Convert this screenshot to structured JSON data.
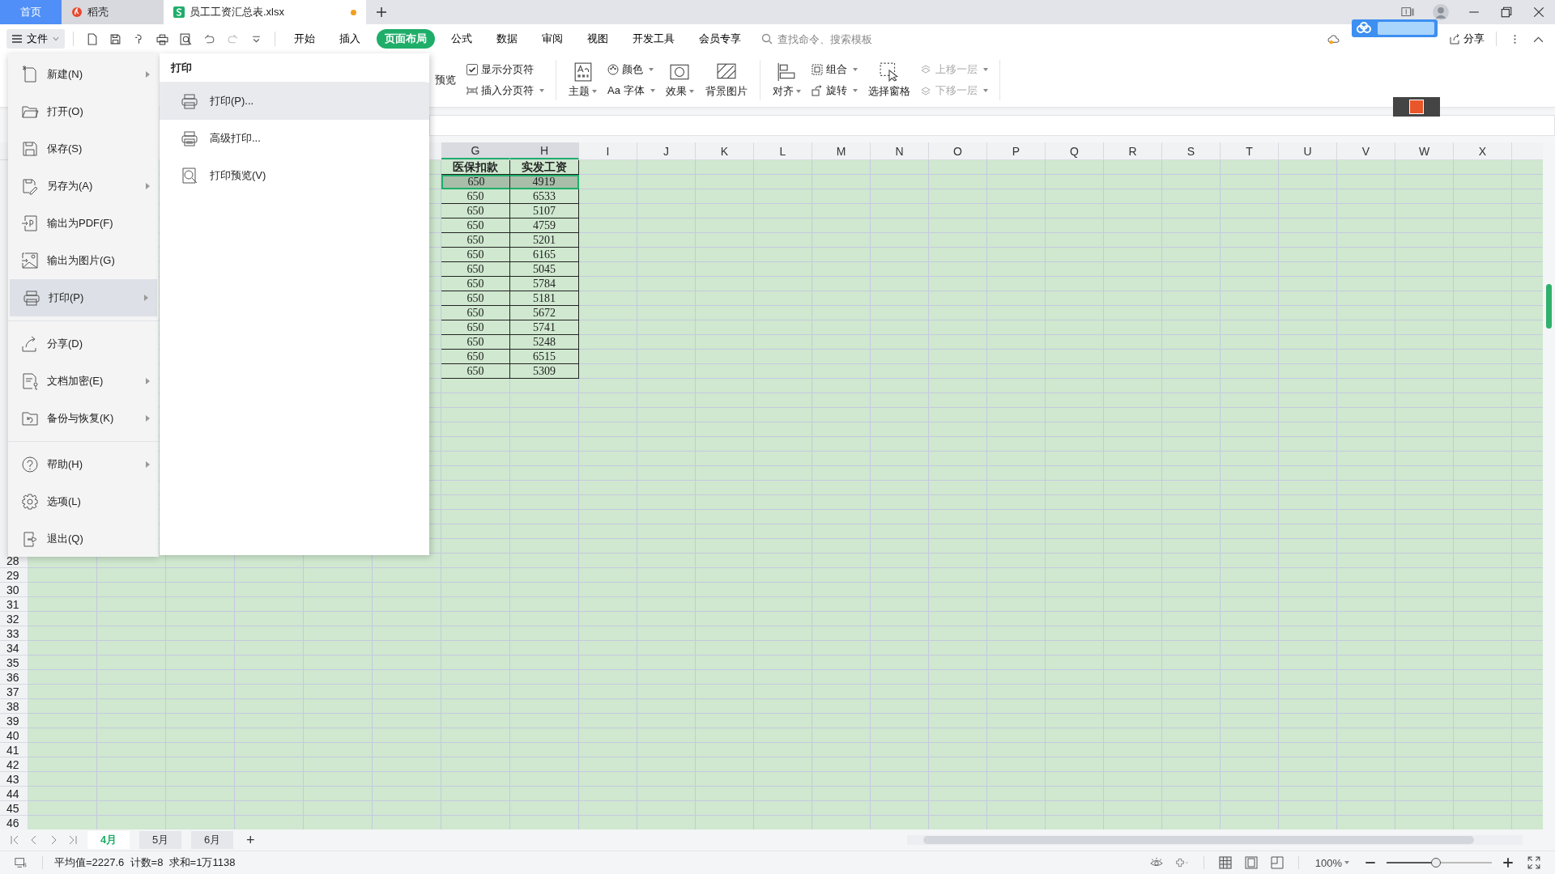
{
  "title_tabs": [
    {
      "label": "首页",
      "kind": "home",
      "selected": false,
      "unsaved": false
    },
    {
      "label": "稻壳",
      "kind": "docer",
      "selected": false,
      "unsaved": false
    },
    {
      "label": "员工工资汇总表.xlsx",
      "kind": "sheet",
      "selected": true,
      "unsaved": true
    }
  ],
  "file_button": "文件",
  "ribbon_tabs": [
    {
      "label": "开始",
      "selected": false
    },
    {
      "label": "插入",
      "selected": false
    },
    {
      "label": "页面布局",
      "selected": true
    },
    {
      "label": "公式",
      "selected": false
    },
    {
      "label": "数据",
      "selected": false
    },
    {
      "label": "审阅",
      "selected": false
    },
    {
      "label": "视图",
      "selected": false
    },
    {
      "label": "开发工具",
      "selected": false
    },
    {
      "label": "会员专享",
      "selected": false
    }
  ],
  "search": {
    "placeholder": "查找命令、搜索模板"
  },
  "share": "分享",
  "ribbon": {
    "preview": "预览",
    "show_page_breaks": {
      "label": "显示分页符",
      "checked": true
    },
    "insert_page_break": "插入分页符",
    "theme": "主题",
    "colors": "颜色",
    "fonts": {
      "prefix": "Aa",
      "label": "字体"
    },
    "effects": "效果",
    "background": "背景图片",
    "align": "对齐",
    "group": "组合",
    "rotate": "旋转",
    "selection_pane": "选择窗格",
    "bring_forward": {
      "label": "上移一层",
      "disabled": true
    },
    "send_backward": {
      "label": "下移一层",
      "disabled": true
    }
  },
  "file_menu": {
    "groups": [
      [
        {
          "label": "新建(N)",
          "kind": "new",
          "submenu": true,
          "selected": false
        },
        {
          "label": "打开(O)",
          "kind": "open",
          "submenu": false,
          "selected": false
        },
        {
          "label": "保存(S)",
          "kind": "save",
          "submenu": false,
          "selected": false
        },
        {
          "label": "另存为(A)",
          "kind": "save_as",
          "submenu": true,
          "selected": false
        },
        {
          "label": "输出为PDF(F)",
          "kind": "pdf",
          "submenu": false,
          "selected": false
        },
        {
          "label": "输出为图片(G)",
          "kind": "image",
          "submenu": false,
          "selected": false
        },
        {
          "label": "打印(P)",
          "kind": "print",
          "submenu": true,
          "selected": true
        }
      ],
      [
        {
          "label": "分享(D)",
          "kind": "share",
          "submenu": false,
          "selected": false
        },
        {
          "label": "文档加密(E)",
          "kind": "encrypt",
          "submenu": true,
          "selected": false
        },
        {
          "label": "备份与恢复(K)",
          "kind": "backup",
          "submenu": true,
          "selected": false
        }
      ],
      [
        {
          "label": "帮助(H)",
          "kind": "help",
          "submenu": true,
          "selected": false
        },
        {
          "label": "选项(L)",
          "kind": "options",
          "submenu": false,
          "selected": false
        },
        {
          "label": "退出(Q)",
          "kind": "exit",
          "submenu": false,
          "selected": false
        }
      ]
    ]
  },
  "submenu": {
    "title": "打印",
    "items": [
      {
        "label": "打印(P)...",
        "kind": "print",
        "selected": true
      },
      {
        "label": "高级打印...",
        "kind": "advanced",
        "selected": false
      },
      {
        "label": "打印预览(V)",
        "kind": "preview",
        "selected": false
      }
    ]
  },
  "columns": [
    "G",
    "H",
    "I",
    "J",
    "K",
    "L",
    "M",
    "N",
    "O",
    "P",
    "Q",
    "R",
    "S",
    "T",
    "U",
    "V",
    "W",
    "X"
  ],
  "table": {
    "header": [
      "医保扣款",
      "实发工资"
    ],
    "rows": [
      {
        "cells": [
          "650",
          "4919"
        ],
        "selected": true
      },
      {
        "cells": [
          "650",
          "6533"
        ],
        "selected": false
      },
      {
        "cells": [
          "650",
          "5107"
        ],
        "selected": false
      },
      {
        "cells": [
          "650",
          "4759"
        ],
        "selected": false
      },
      {
        "cells": [
          "650",
          "5201"
        ],
        "selected": false
      },
      {
        "cells": [
          "650",
          "6165"
        ],
        "selected": false
      },
      {
        "cells": [
          "650",
          "5045"
        ],
        "selected": false
      },
      {
        "cells": [
          "650",
          "5784"
        ],
        "selected": false
      },
      {
        "cells": [
          "650",
          "5181"
        ],
        "selected": false
      },
      {
        "cells": [
          "650",
          "5672"
        ],
        "selected": false
      },
      {
        "cells": [
          "650",
          "5741"
        ],
        "selected": false
      },
      {
        "cells": [
          "650",
          "5248"
        ],
        "selected": false
      },
      {
        "cells": [
          "650",
          "6515"
        ],
        "selected": false
      },
      {
        "cells": [
          "650",
          "5309"
        ],
        "selected": false
      }
    ]
  },
  "row_numbers": [
    "28",
    "29",
    "30",
    "31",
    "32",
    "33",
    "34",
    "35",
    "36",
    "37",
    "38",
    "39",
    "40",
    "41",
    "42",
    "43",
    "44",
    "45",
    "46"
  ],
  "sheet_tabs": [
    {
      "label": "4月",
      "selected": true
    },
    {
      "label": "5月",
      "selected": false
    },
    {
      "label": "6月",
      "selected": false
    }
  ],
  "add_sheet": "+",
  "status_bar": {
    "stats": "平均值=2227.6  计数=8  求和=1万1138",
    "zoom": "100%",
    "zoom_level": {
      "level": 0.47
    }
  }
}
